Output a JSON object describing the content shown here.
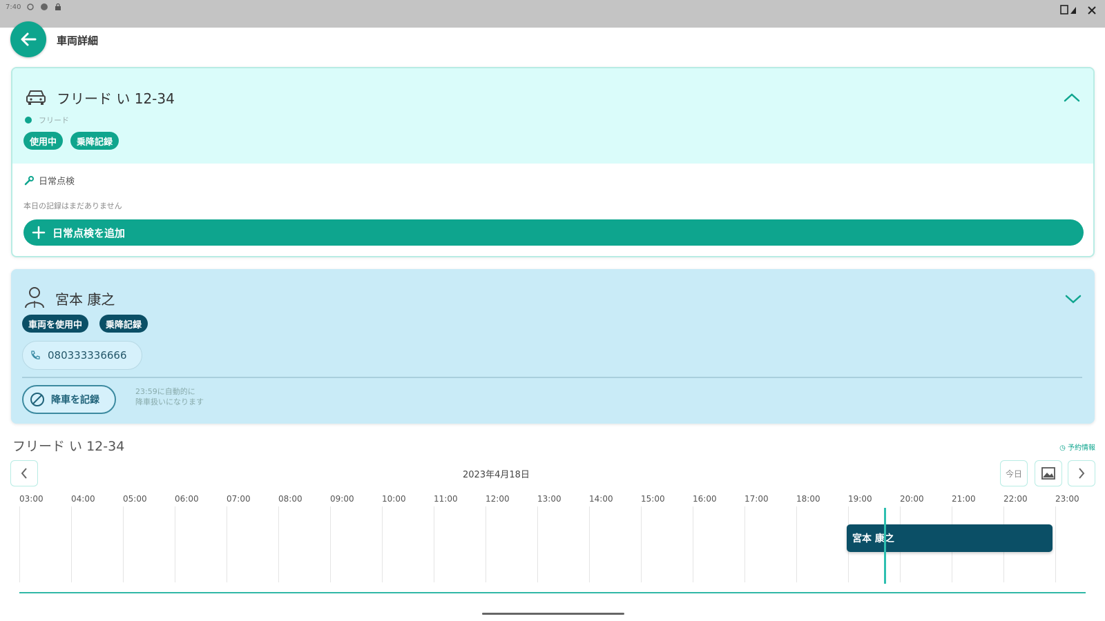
{
  "status_bar": {
    "time": "7:40"
  },
  "header": {
    "title": "車両詳細"
  },
  "vehicle_card": {
    "name": "フリード い 12-34",
    "type": "フリード",
    "badges": [
      "使用中",
      "乗降記録"
    ],
    "section_title": "日常点検",
    "note": "本日の記録はまだありません",
    "add_button_label": "日常点検を追加"
  },
  "driver_card": {
    "name": "宮本 康之",
    "badges": [
      "車両を使用中",
      "乗降記録"
    ],
    "phone": "080333336666",
    "record_button_label": "降車を記録",
    "auto_note_line1": "23:59に自動的に",
    "auto_note_line2": "降車扱いになります"
  },
  "schedule": {
    "title": "フリード い 12-34",
    "reserve_link": "予約情報",
    "date": "2023年4月18日",
    "today_label": "今日",
    "hours": [
      "03:00",
      "04:00",
      "05:00",
      "06:00",
      "07:00",
      "08:00",
      "09:00",
      "10:00",
      "11:00",
      "12:00",
      "13:00",
      "14:00",
      "15:00",
      "16:00",
      "17:00",
      "18:00",
      "19:00",
      "20:00",
      "21:00",
      "22:00",
      "23:00"
    ],
    "event_label": "宮本 康之"
  },
  "colors": {
    "accent": "#0ea58e",
    "dark": "#0b4f66",
    "vehicle_header_bg": "#dafcfa",
    "driver_card_bg": "#c9ebf7"
  }
}
